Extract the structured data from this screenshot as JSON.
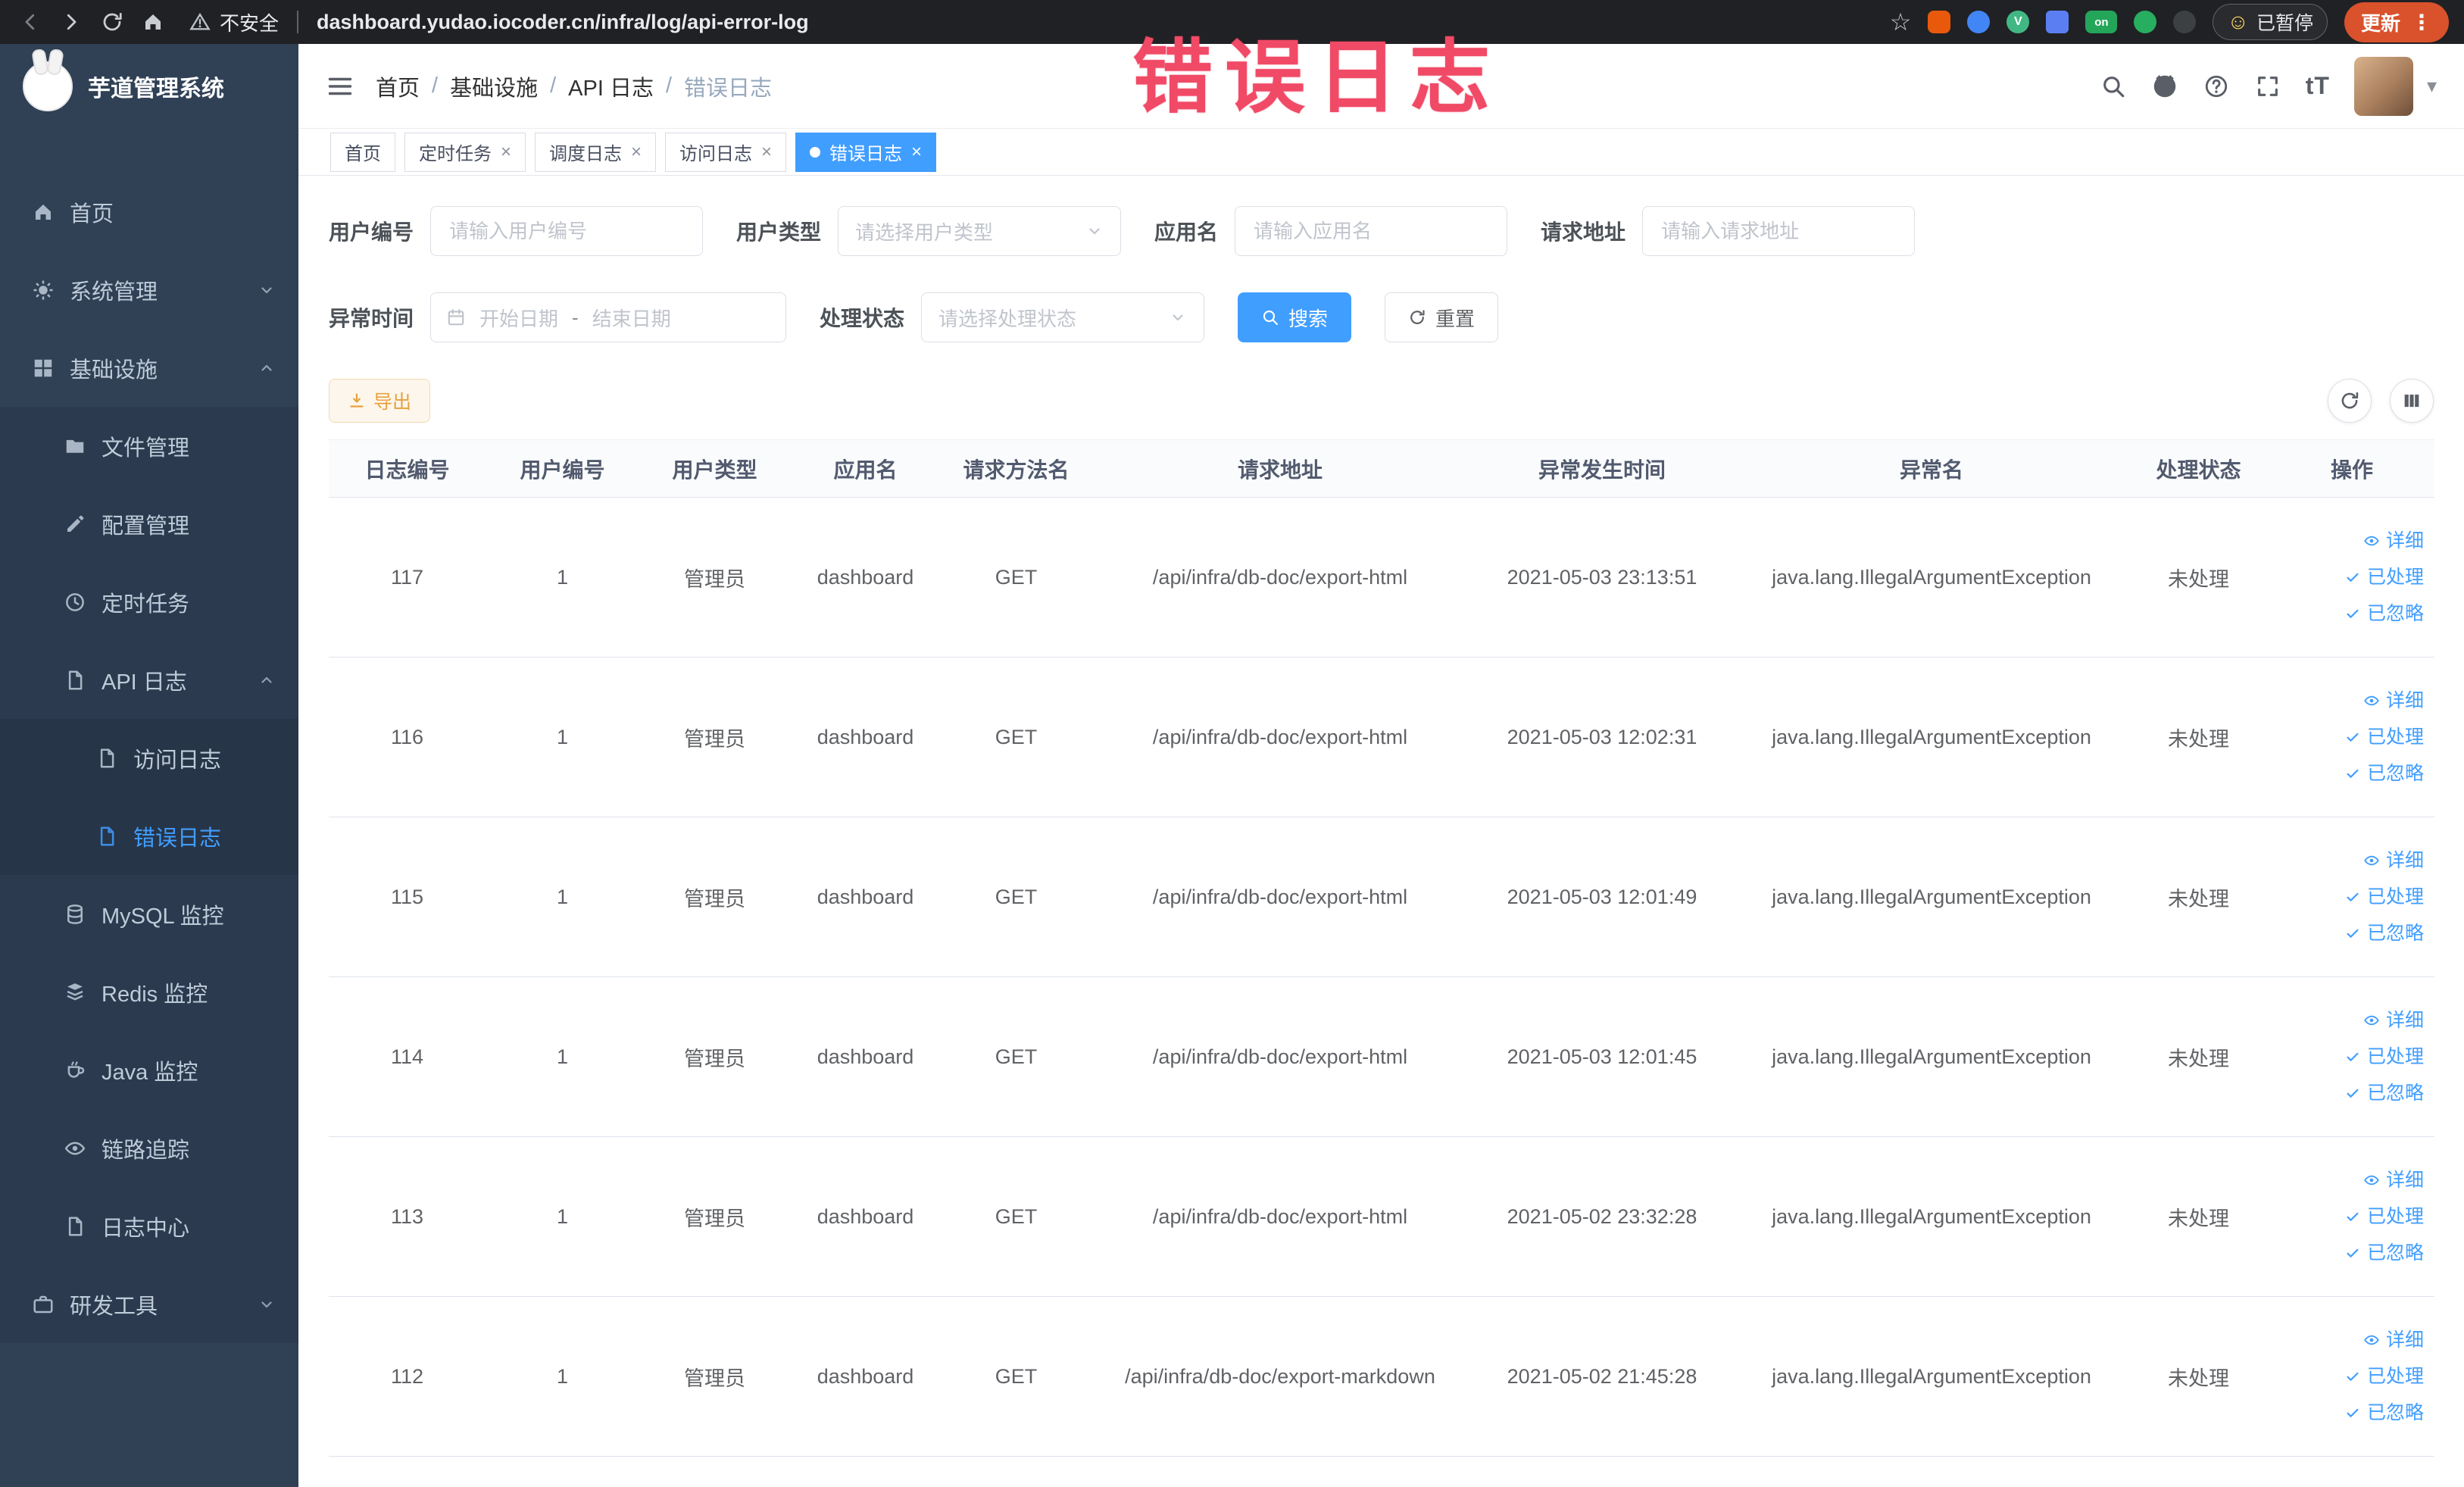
{
  "browser": {
    "security_label": "不安全",
    "url": "dashboard.yudao.iocoder.cn/infra/log/api-error-log",
    "paused_badge": "已暂停",
    "update_button": "更新",
    "ext_on_label": "on"
  },
  "sidebar": {
    "logo_title": "芋道管理系统",
    "items": [
      {
        "label": "首页"
      },
      {
        "label": "系统管理"
      },
      {
        "label": "基础设施"
      },
      {
        "label": "文件管理"
      },
      {
        "label": "配置管理"
      },
      {
        "label": "定时任务"
      },
      {
        "label": "API 日志"
      },
      {
        "label": "访问日志"
      },
      {
        "label": "错误日志"
      },
      {
        "label": "MySQL 监控"
      },
      {
        "label": "Redis 监控"
      },
      {
        "label": "Java 监控"
      },
      {
        "label": "链路追踪"
      },
      {
        "label": "日志中心"
      },
      {
        "label": "研发工具"
      }
    ]
  },
  "header": {
    "breadcrumb": [
      "首页",
      "基础设施",
      "API 日志",
      "错误日志"
    ]
  },
  "annotation": "错误日志",
  "tabs": [
    {
      "label": "首页"
    },
    {
      "label": "定时任务"
    },
    {
      "label": "调度日志"
    },
    {
      "label": "访问日志"
    },
    {
      "label": "错误日志"
    }
  ],
  "filters": {
    "user_id": {
      "label": "用户编号",
      "placeholder": "请输入用户编号"
    },
    "user_type": {
      "label": "用户类型",
      "placeholder": "请选择用户类型"
    },
    "app_name": {
      "label": "应用名",
      "placeholder": "请输入应用名"
    },
    "request_url": {
      "label": "请求地址",
      "placeholder": "请输入请求地址"
    },
    "exception_time": {
      "label": "异常时间",
      "start_placeholder": "开始日期",
      "separator": "-",
      "end_placeholder": "结束日期"
    },
    "process_status": {
      "label": "处理状态",
      "placeholder": "请选择处理状态"
    },
    "search_button": "搜索",
    "reset_button": "重置"
  },
  "toolbar": {
    "export_button": "导出"
  },
  "table": {
    "headers": [
      "日志编号",
      "用户编号",
      "用户类型",
      "应用名",
      "请求方法名",
      "请求地址",
      "异常发生时间",
      "异常名",
      "处理状态",
      "操作"
    ],
    "actions": [
      "详细",
      "已处理",
      "已忽略"
    ],
    "rows": [
      {
        "id": "117",
        "user_id": "1",
        "user_type": "管理员",
        "app": "dashboard",
        "method": "GET",
        "url": "/api/infra/db-doc/export-html",
        "time": "2021-05-03 23:13:51",
        "exception": "java.lang.IllegalArgumentException",
        "status": "未处理"
      },
      {
        "id": "116",
        "user_id": "1",
        "user_type": "管理员",
        "app": "dashboard",
        "method": "GET",
        "url": "/api/infra/db-doc/export-html",
        "time": "2021-05-03 12:02:31",
        "exception": "java.lang.IllegalArgumentException",
        "status": "未处理"
      },
      {
        "id": "115",
        "user_id": "1",
        "user_type": "管理员",
        "app": "dashboard",
        "method": "GET",
        "url": "/api/infra/db-doc/export-html",
        "time": "2021-05-03 12:01:49",
        "exception": "java.lang.IllegalArgumentException",
        "status": "未处理"
      },
      {
        "id": "114",
        "user_id": "1",
        "user_type": "管理员",
        "app": "dashboard",
        "method": "GET",
        "url": "/api/infra/db-doc/export-html",
        "time": "2021-05-03 12:01:45",
        "exception": "java.lang.IllegalArgumentException",
        "status": "未处理"
      },
      {
        "id": "113",
        "user_id": "1",
        "user_type": "管理员",
        "app": "dashboard",
        "method": "GET",
        "url": "/api/infra/db-doc/export-html",
        "time": "2021-05-02 23:32:28",
        "exception": "java.lang.IllegalArgumentException",
        "status": "未处理"
      },
      {
        "id": "112",
        "user_id": "1",
        "user_type": "管理员",
        "app": "dashboard",
        "method": "GET",
        "url": "/api/infra/db-doc/export-markdown",
        "time": "2021-05-02 21:45:28",
        "exception": "java.lang.IllegalArgumentException",
        "status": "未处理"
      }
    ]
  },
  "icons": {
    "close": "×",
    "slash": "/",
    "caret": "▾",
    "kebab": "⋮",
    "star": "☆",
    "font_size": "tT",
    "smiley": "☺"
  },
  "colors": {
    "primary": "#409eff",
    "sidebar_bg": "#304156",
    "tag_active_bg": "#409eff",
    "warning_text": "#e6a23c",
    "annotation": "#f04a66"
  }
}
